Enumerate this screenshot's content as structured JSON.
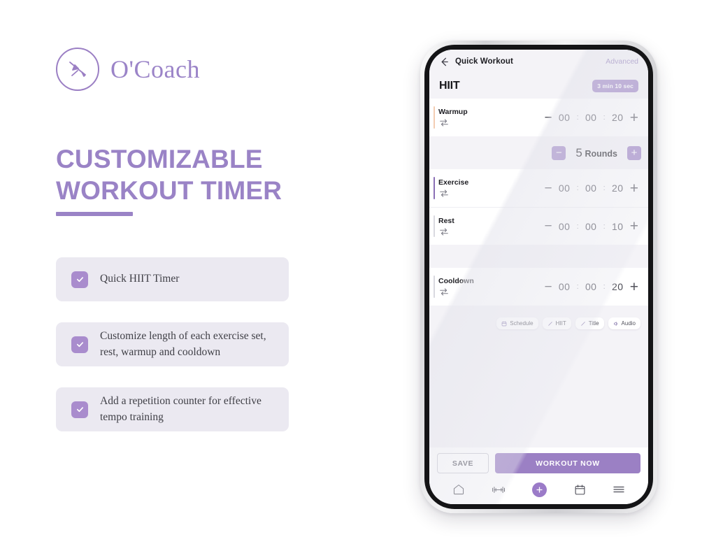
{
  "brand": {
    "name": "O'Coach",
    "logo_icon": "coach-whistle-icon"
  },
  "headline": {
    "line1": "CUSTOMIZABLE",
    "line2": "WORKOUT TIMER"
  },
  "features": [
    {
      "check_icon": "check-icon",
      "text": "Quick HIIT Timer"
    },
    {
      "check_icon": "check-icon",
      "text": "Customize length of each exercise set, rest, warmup and cooldown"
    },
    {
      "check_icon": "check-icon",
      "text": "Add a repetition counter for effective tempo training"
    }
  ],
  "phone": {
    "topbar": {
      "back_icon": "back-arrow-icon",
      "title": "Quick Workout",
      "advanced_label": "Advanced"
    },
    "workout": {
      "name": "HIIT",
      "duration_badge": "3 min 10 sec"
    },
    "segments": [
      {
        "label": "Warmup",
        "repeat_icon": "repeat-icon",
        "accent_color": "#f3cdb2",
        "minus_label": "−",
        "plus_label": "+",
        "hours": "00",
        "minutes": "00",
        "seconds": "20",
        "separator": ":"
      },
      {
        "label": "Exercise",
        "repeat_icon": "repeat-icon",
        "accent_color": "#8a6fb5",
        "minus_label": "−",
        "plus_label": "+",
        "hours": "00",
        "minutes": "00",
        "seconds": "20",
        "separator": ":"
      },
      {
        "label": "Rest",
        "repeat_icon": "repeat-icon",
        "accent_color": "#d9d9e0",
        "minus_label": "−",
        "plus_label": "+",
        "hours": "00",
        "minutes": "00",
        "seconds": "10",
        "separator": ":"
      },
      {
        "label": "Cooldown",
        "repeat_icon": "repeat-icon",
        "accent_color": "#d9d9e0",
        "minus_label": "−",
        "plus_label": "+",
        "hours": "00",
        "minutes": "00",
        "seconds": "20",
        "separator": ":"
      }
    ],
    "rounds": {
      "minus_label": "−",
      "plus_label": "+",
      "count": "5",
      "unit_label": "Rounds"
    },
    "chips": [
      {
        "icon": "calendar-icon",
        "label": "Schedule"
      },
      {
        "icon": "pencil-icon",
        "label": "HIIT"
      },
      {
        "icon": "pencil-icon",
        "label": "Title"
      },
      {
        "icon": "audio-icon",
        "label": "Audio"
      }
    ],
    "footer": {
      "save_label": "SAVE",
      "workout_now_label": "WORKOUT NOW"
    },
    "navbar": [
      {
        "icon": "home-icon"
      },
      {
        "icon": "dumbbell-icon"
      },
      {
        "icon": "plus-circle-icon"
      },
      {
        "icon": "calendar-icon"
      },
      {
        "icon": "hamburger-menu-icon"
      }
    ]
  },
  "colors": {
    "accent_purple": "#9b80c4",
    "headline_purple": "#9a83c6",
    "feature_bg": "#ebe9f1",
    "screen_bg": "#f4f3f7"
  }
}
